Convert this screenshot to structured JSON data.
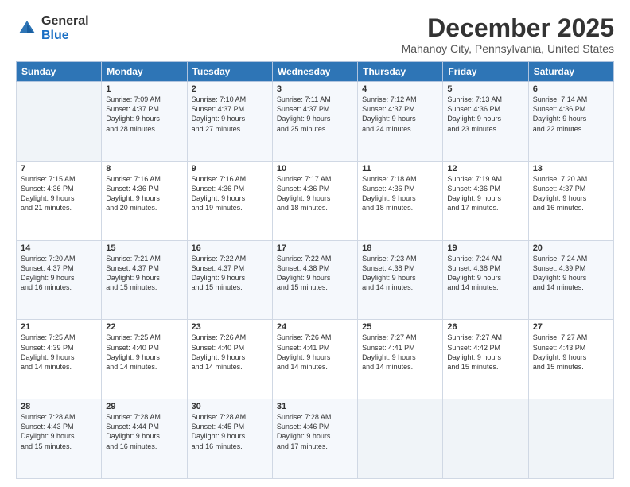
{
  "logo": {
    "general": "General",
    "blue": "Blue"
  },
  "header": {
    "title": "December 2025",
    "subtitle": "Mahanoy City, Pennsylvania, United States"
  },
  "days_of_week": [
    "Sunday",
    "Monday",
    "Tuesday",
    "Wednesday",
    "Thursday",
    "Friday",
    "Saturday"
  ],
  "weeks": [
    [
      {
        "day": "",
        "info": ""
      },
      {
        "day": "1",
        "info": "Sunrise: 7:09 AM\nSunset: 4:37 PM\nDaylight: 9 hours\nand 28 minutes."
      },
      {
        "day": "2",
        "info": "Sunrise: 7:10 AM\nSunset: 4:37 PM\nDaylight: 9 hours\nand 27 minutes."
      },
      {
        "day": "3",
        "info": "Sunrise: 7:11 AM\nSunset: 4:37 PM\nDaylight: 9 hours\nand 25 minutes."
      },
      {
        "day": "4",
        "info": "Sunrise: 7:12 AM\nSunset: 4:37 PM\nDaylight: 9 hours\nand 24 minutes."
      },
      {
        "day": "5",
        "info": "Sunrise: 7:13 AM\nSunset: 4:36 PM\nDaylight: 9 hours\nand 23 minutes."
      },
      {
        "day": "6",
        "info": "Sunrise: 7:14 AM\nSunset: 4:36 PM\nDaylight: 9 hours\nand 22 minutes."
      }
    ],
    [
      {
        "day": "7",
        "info": "Sunrise: 7:15 AM\nSunset: 4:36 PM\nDaylight: 9 hours\nand 21 minutes."
      },
      {
        "day": "8",
        "info": "Sunrise: 7:16 AM\nSunset: 4:36 PM\nDaylight: 9 hours\nand 20 minutes."
      },
      {
        "day": "9",
        "info": "Sunrise: 7:16 AM\nSunset: 4:36 PM\nDaylight: 9 hours\nand 19 minutes."
      },
      {
        "day": "10",
        "info": "Sunrise: 7:17 AM\nSunset: 4:36 PM\nDaylight: 9 hours\nand 18 minutes."
      },
      {
        "day": "11",
        "info": "Sunrise: 7:18 AM\nSunset: 4:36 PM\nDaylight: 9 hours\nand 18 minutes."
      },
      {
        "day": "12",
        "info": "Sunrise: 7:19 AM\nSunset: 4:36 PM\nDaylight: 9 hours\nand 17 minutes."
      },
      {
        "day": "13",
        "info": "Sunrise: 7:20 AM\nSunset: 4:37 PM\nDaylight: 9 hours\nand 16 minutes."
      }
    ],
    [
      {
        "day": "14",
        "info": "Sunrise: 7:20 AM\nSunset: 4:37 PM\nDaylight: 9 hours\nand 16 minutes."
      },
      {
        "day": "15",
        "info": "Sunrise: 7:21 AM\nSunset: 4:37 PM\nDaylight: 9 hours\nand 15 minutes."
      },
      {
        "day": "16",
        "info": "Sunrise: 7:22 AM\nSunset: 4:37 PM\nDaylight: 9 hours\nand 15 minutes."
      },
      {
        "day": "17",
        "info": "Sunrise: 7:22 AM\nSunset: 4:38 PM\nDaylight: 9 hours\nand 15 minutes."
      },
      {
        "day": "18",
        "info": "Sunrise: 7:23 AM\nSunset: 4:38 PM\nDaylight: 9 hours\nand 14 minutes."
      },
      {
        "day": "19",
        "info": "Sunrise: 7:24 AM\nSunset: 4:38 PM\nDaylight: 9 hours\nand 14 minutes."
      },
      {
        "day": "20",
        "info": "Sunrise: 7:24 AM\nSunset: 4:39 PM\nDaylight: 9 hours\nand 14 minutes."
      }
    ],
    [
      {
        "day": "21",
        "info": "Sunrise: 7:25 AM\nSunset: 4:39 PM\nDaylight: 9 hours\nand 14 minutes."
      },
      {
        "day": "22",
        "info": "Sunrise: 7:25 AM\nSunset: 4:40 PM\nDaylight: 9 hours\nand 14 minutes."
      },
      {
        "day": "23",
        "info": "Sunrise: 7:26 AM\nSunset: 4:40 PM\nDaylight: 9 hours\nand 14 minutes."
      },
      {
        "day": "24",
        "info": "Sunrise: 7:26 AM\nSunset: 4:41 PM\nDaylight: 9 hours\nand 14 minutes."
      },
      {
        "day": "25",
        "info": "Sunrise: 7:27 AM\nSunset: 4:41 PM\nDaylight: 9 hours\nand 14 minutes."
      },
      {
        "day": "26",
        "info": "Sunrise: 7:27 AM\nSunset: 4:42 PM\nDaylight: 9 hours\nand 15 minutes."
      },
      {
        "day": "27",
        "info": "Sunrise: 7:27 AM\nSunset: 4:43 PM\nDaylight: 9 hours\nand 15 minutes."
      }
    ],
    [
      {
        "day": "28",
        "info": "Sunrise: 7:28 AM\nSunset: 4:43 PM\nDaylight: 9 hours\nand 15 minutes."
      },
      {
        "day": "29",
        "info": "Sunrise: 7:28 AM\nSunset: 4:44 PM\nDaylight: 9 hours\nand 16 minutes."
      },
      {
        "day": "30",
        "info": "Sunrise: 7:28 AM\nSunset: 4:45 PM\nDaylight: 9 hours\nand 16 minutes."
      },
      {
        "day": "31",
        "info": "Sunrise: 7:28 AM\nSunset: 4:46 PM\nDaylight: 9 hours\nand 17 minutes."
      },
      {
        "day": "",
        "info": ""
      },
      {
        "day": "",
        "info": ""
      },
      {
        "day": "",
        "info": ""
      }
    ]
  ]
}
